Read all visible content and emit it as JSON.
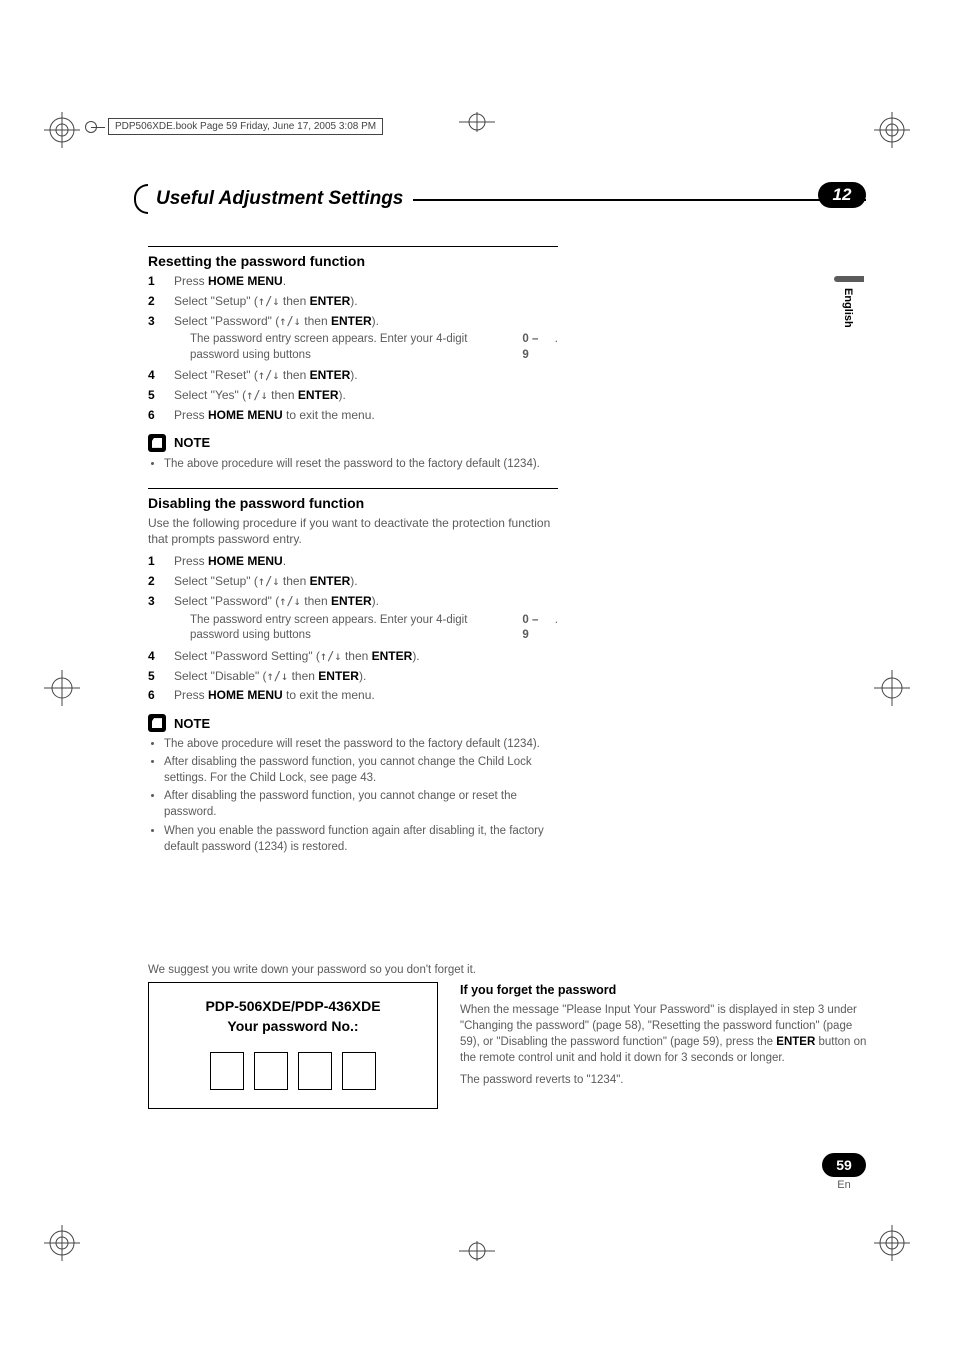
{
  "print_header": "PDP506XDE.book  Page 59  Friday, June 17, 2005  3:08 PM",
  "chapter": {
    "title": "Useful Adjustment Settings",
    "number": "12"
  },
  "lang_tab": "English",
  "page": {
    "number": "59",
    "lang_abbr": "En"
  },
  "section1": {
    "title": "Resetting the password function",
    "steps": [
      {
        "n": "1",
        "pre": "Press ",
        "bold": "HOME MENU",
        "post": "."
      },
      {
        "n": "2",
        "pre": "Select \"Setup\" (",
        "arrows": "↑/↓",
        "mid": " then ",
        "bold": "ENTER",
        "post": ")."
      },
      {
        "n": "3",
        "pre": "Select \"Password\" (",
        "arrows": "↑/↓",
        "mid": " then ",
        "bold": "ENTER",
        "post": ").",
        "sub": {
          "pre": "The password entry screen appears. Enter your 4-digit password using buttons ",
          "bold": "0 – 9",
          "post": "."
        }
      },
      {
        "n": "4",
        "pre": "Select \"Reset\" (",
        "arrows": "↑/↓",
        "mid": " then ",
        "bold": "ENTER",
        "post": ")."
      },
      {
        "n": "5",
        "pre": "Select \"Yes\" (",
        "arrows": "↑/↓",
        "mid": " then ",
        "bold": "ENTER",
        "post": ")."
      },
      {
        "n": "6",
        "pre": "Press ",
        "bold": "HOME MENU",
        "post": " to exit the menu."
      }
    ],
    "note_label": "NOTE",
    "notes": [
      "The above procedure will reset the password to the factory default (1234)."
    ]
  },
  "section2": {
    "title": "Disabling the password function",
    "lead": "Use the following procedure if you want to deactivate the protection function that prompts password entry.",
    "steps": [
      {
        "n": "1",
        "pre": "Press ",
        "bold": "HOME MENU",
        "post": "."
      },
      {
        "n": "2",
        "pre": "Select \"Setup\" (",
        "arrows": "↑/↓",
        "mid": " then ",
        "bold": "ENTER",
        "post": ")."
      },
      {
        "n": "3",
        "pre": "Select \"Password\" (",
        "arrows": "↑/↓",
        "mid": " then ",
        "bold": "ENTER",
        "post": ").",
        "sub": {
          "pre": "The password entry screen appears. Enter your 4-digit password using buttons ",
          "bold": "0 – 9",
          "post": "."
        }
      },
      {
        "n": "4",
        "pre": "Select \"Password Setting\" (",
        "arrows": "↑/↓",
        "mid": " then ",
        "bold": "ENTER",
        "post": ")."
      },
      {
        "n": "5",
        "pre": "Select \"Disable\" (",
        "arrows": "↑/↓",
        "mid": " then ",
        "bold": "ENTER",
        "post": ")."
      },
      {
        "n": "6",
        "pre": "Press ",
        "bold": "HOME MENU",
        "post": " to exit the menu."
      }
    ],
    "note_label": "NOTE",
    "notes": [
      "The above procedure will reset the password to the factory default (1234).",
      "After disabling the password function, you cannot change the Child Lock settings. For the Child Lock, see page 43.",
      "After disabling the password function, you cannot change or reset the password.",
      "When you enable the password function again after disabling it, the factory default password (1234) is restored."
    ]
  },
  "suggest": {
    "lead": "We suggest you write down your password so you don't forget it.",
    "box_line1": "PDP-506XDE/PDP-436XDE",
    "box_line2": "Your password No.:",
    "forgot_title": "If you forget the password",
    "forgot_p1_pre": "When the message \"Please Input Your Password\" is displayed in step 3 under \"Changing the password\" (page 58), \"Resetting the password function\" (page 59), or \"Disabling the password function\" (page 59), press the ",
    "forgot_p1_bold": "ENTER",
    "forgot_p1_post": " button on the remote control unit and hold it down for 3 seconds or longer.",
    "forgot_p2": "The password reverts to \"1234\"."
  }
}
